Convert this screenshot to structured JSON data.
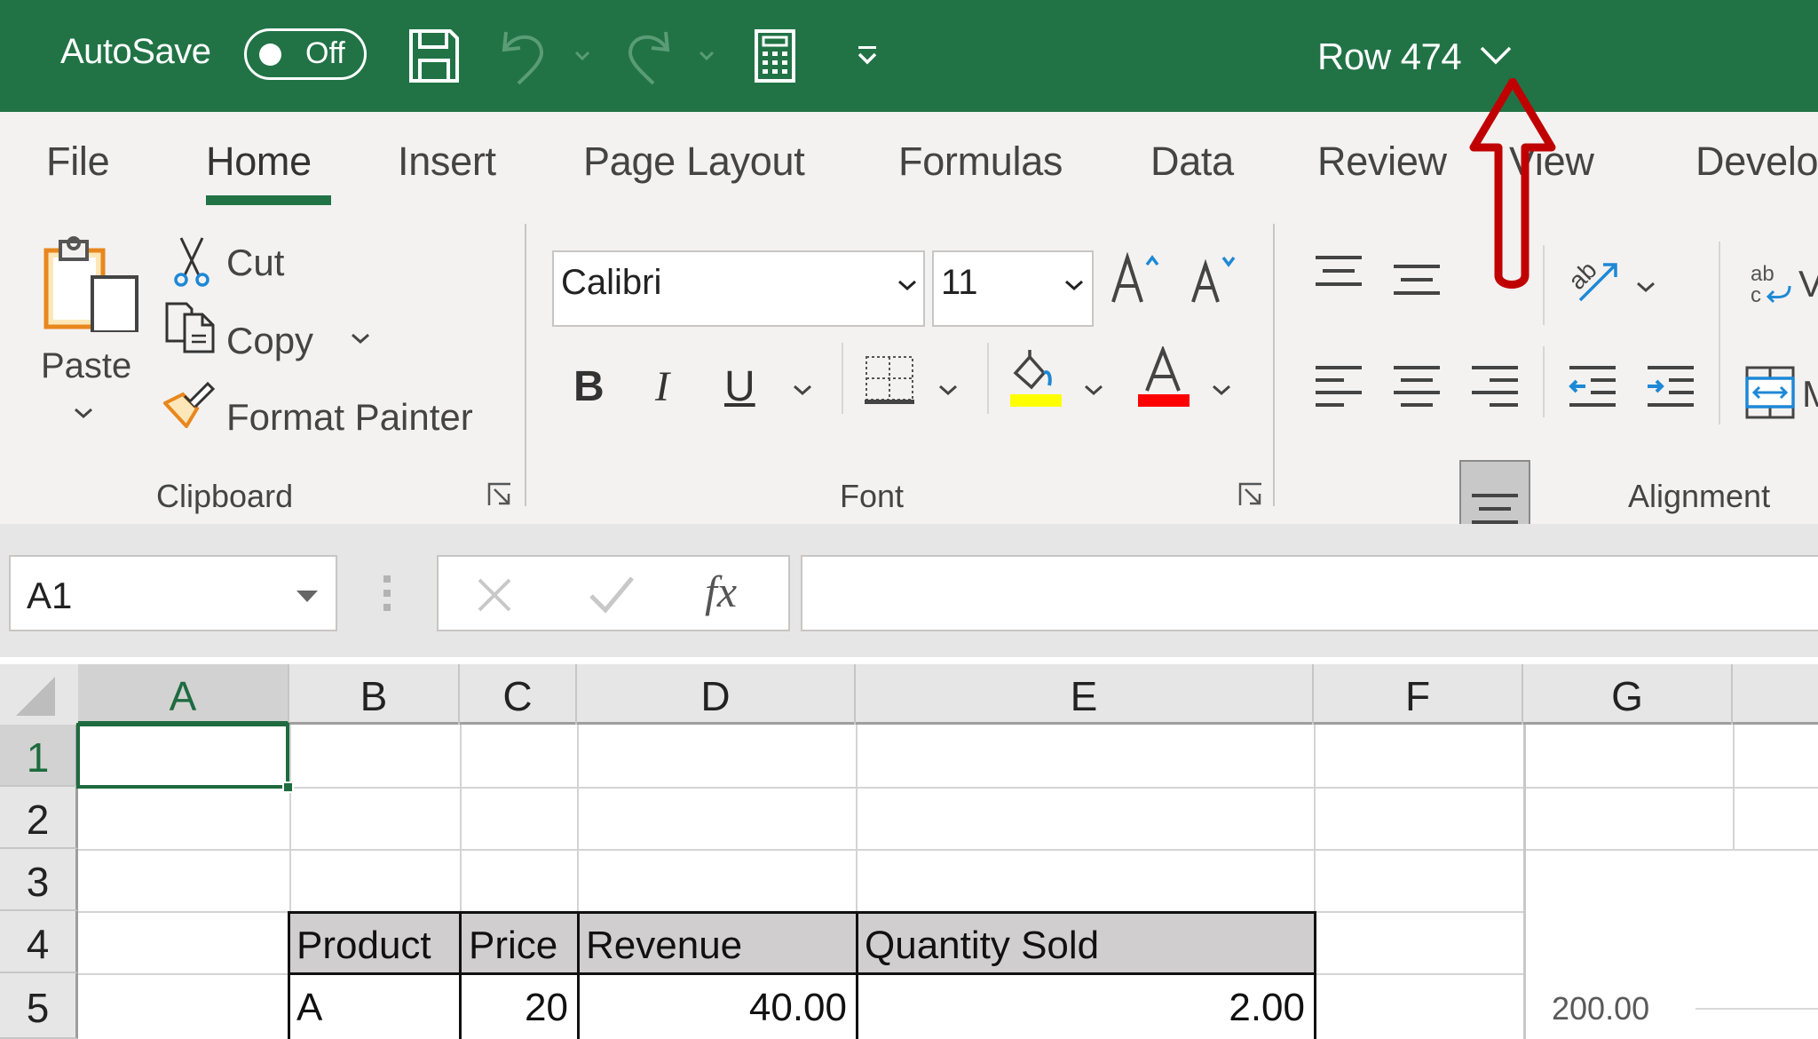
{
  "titlebar": {
    "autosave_label": "AutoSave",
    "autosave_state": "Off",
    "document_title": "Row 474",
    "icons": [
      "save-icon",
      "undo-icon",
      "undo-dropdown-icon",
      "redo-icon",
      "redo-dropdown-icon",
      "calculator-icon",
      "customize-qat-icon",
      "chevron-down-icon"
    ]
  },
  "tabs": [
    {
      "label": "File",
      "active": false
    },
    {
      "label": "Home",
      "active": true
    },
    {
      "label": "Insert",
      "active": false
    },
    {
      "label": "Page Layout",
      "active": false
    },
    {
      "label": "Formulas",
      "active": false
    },
    {
      "label": "Data",
      "active": false
    },
    {
      "label": "Review",
      "active": false
    },
    {
      "label": "View",
      "active": false
    },
    {
      "label": "Develo",
      "active": false
    }
  ],
  "ribbon": {
    "clipboard": {
      "group_label": "Clipboard",
      "paste_label": "Paste",
      "cut_label": "Cut",
      "copy_label": "Copy",
      "format_painter_label": "Format Painter"
    },
    "font": {
      "group_label": "Font",
      "font_name": "Calibri",
      "font_size": "11",
      "bold_glyph": "B",
      "italic_glyph": "I",
      "underline_glyph": "U",
      "fill_color": "#FFFF00",
      "font_color": "#FF0000"
    },
    "alignment": {
      "group_label": "Alignment",
      "wrap_text_partial": "V",
      "merge_partial": "M",
      "pressed_button": "bottom-align"
    }
  },
  "formula_bar": {
    "name_box": "A1",
    "fx_label": "fx",
    "formula_value": ""
  },
  "grid": {
    "columns": [
      "A",
      "B",
      "C",
      "D",
      "E",
      "F",
      "G"
    ],
    "rows": [
      "1",
      "2",
      "3",
      "4",
      "5"
    ],
    "selected_cell": "A1",
    "table": {
      "headers": [
        "Product",
        "Price",
        "Revenue",
        "Quantity Sold"
      ],
      "rows": [
        [
          "A",
          "20",
          "40.00",
          "2.00"
        ]
      ]
    },
    "chart_axis_label": "200.00"
  },
  "colors": {
    "excel_green": "#217346",
    "annotation_red": "#C00000",
    "header_fill": "#D0CECE"
  }
}
